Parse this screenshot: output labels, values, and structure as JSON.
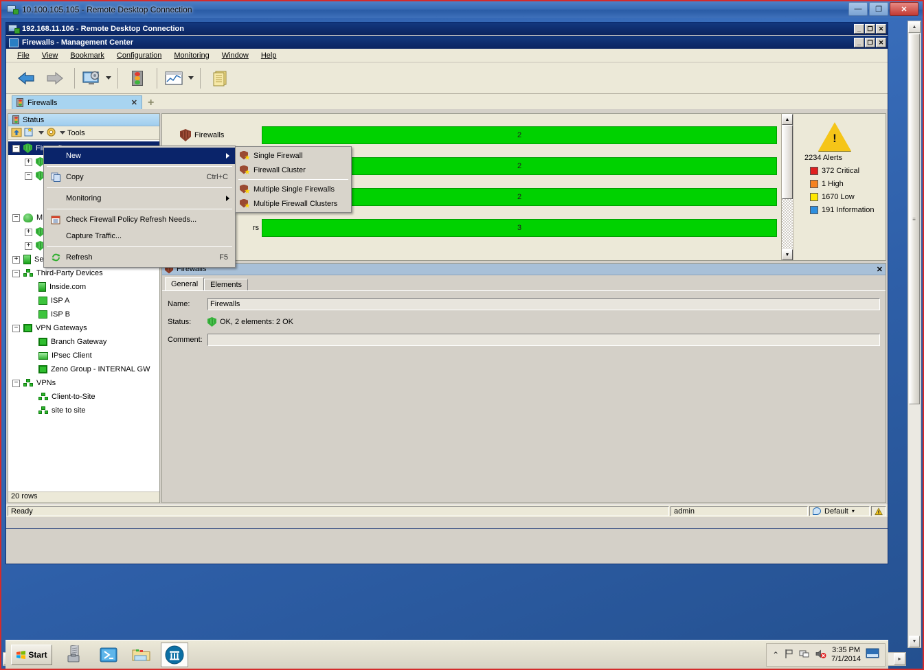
{
  "outer_window": {
    "title": "10.100.105.105 - Remote Desktop Connection",
    "icon": "remote-desktop-icon",
    "minimize": "—",
    "maximize": "❐",
    "close": "✕"
  },
  "inner_window": {
    "title": "192.168.11.106 - Remote Desktop Connection",
    "icon": "remote-desktop-icon",
    "minimize": "_",
    "restore": "❐",
    "close": "✕"
  },
  "app_window": {
    "title": "Firewalls - Management Center",
    "icon": "management-center-icon",
    "minimize": "_",
    "restore": "❐",
    "close": "✕"
  },
  "menubar": [
    {
      "label": "File",
      "accel": "F"
    },
    {
      "label": "View",
      "accel": "V"
    },
    {
      "label": "Bookmark",
      "accel": "B"
    },
    {
      "label": "Configuration",
      "accel": "C"
    },
    {
      "label": "Monitoring",
      "accel": "M"
    },
    {
      "label": "Window",
      "accel": "W"
    },
    {
      "label": "Help",
      "accel": "H"
    }
  ],
  "toolbar": {
    "back": "back-arrow-icon",
    "forward": "forward-arrow-icon",
    "monitoring_view": "monitoring-view-icon",
    "status_view": "traffic-light-icon",
    "reports": "chart-icon",
    "logs": "documents-icon"
  },
  "tabs": [
    {
      "label": "Firewalls",
      "icon": "traffic-light-icon",
      "close": "✕",
      "active": true
    }
  ],
  "tab_add": "+",
  "left_pane": {
    "header": {
      "title": "Status",
      "icon": "traffic-light-icon"
    },
    "tools": {
      "up_icon": "up-folder-icon",
      "new_icon": "new-element-icon",
      "gear_icon": "gear-icon",
      "tools_label": "Tools"
    },
    "tree": [
      {
        "label": "Firewalls",
        "indent": 0,
        "expander": "−",
        "icon": "shield-green",
        "selected": true
      },
      {
        "label": "",
        "indent": 1,
        "expander": "+",
        "icon": "shield-green",
        "selected": false
      },
      {
        "label": "",
        "indent": 1,
        "expander": "−",
        "icon": "shield-green",
        "selected": false
      },
      {
        "label": "",
        "indent": 2,
        "expander": "",
        "icon": "",
        "selected": false
      },
      {
        "label": "",
        "indent": 2,
        "expander": "",
        "icon": "",
        "selected": false
      },
      {
        "label": "M",
        "indent": 0,
        "expander": "−",
        "icon": "ips-green",
        "selected": false
      },
      {
        "label": "",
        "indent": 1,
        "expander": "+",
        "icon": "shield-green",
        "selected": false
      },
      {
        "label": "",
        "indent": 1,
        "expander": "+",
        "icon": "shield-green",
        "selected": false
      },
      {
        "label": "Servers",
        "indent": 0,
        "expander": "+",
        "icon": "server-green",
        "selected": false
      },
      {
        "label": "Third-Party Devices",
        "indent": 0,
        "expander": "−",
        "icon": "thirdparty-green",
        "selected": false
      },
      {
        "label": "Inside.com",
        "indent": 1,
        "expander": "",
        "icon": "server-green",
        "selected": false
      },
      {
        "label": "ISP A",
        "indent": 1,
        "expander": "",
        "icon": "router-green",
        "selected": false
      },
      {
        "label": "ISP B",
        "indent": 1,
        "expander": "",
        "icon": "router-green",
        "selected": false
      },
      {
        "label": "VPN Gateways",
        "indent": 0,
        "expander": "−",
        "icon": "gateway-green",
        "selected": false
      },
      {
        "label": "Branch Gateway",
        "indent": 1,
        "expander": "",
        "icon": "gateway-green",
        "selected": false
      },
      {
        "label": "IPsec Client",
        "indent": 1,
        "expander": "",
        "icon": "laptop-green",
        "selected": false
      },
      {
        "label": "Zeno Group -  INTERNAL GW",
        "indent": 1,
        "expander": "",
        "icon": "gateway-green",
        "selected": false
      },
      {
        "label": "VPNs",
        "indent": 0,
        "expander": "−",
        "icon": "vpn-green",
        "selected": false
      },
      {
        "label": "Client-to-Site",
        "indent": 1,
        "expander": "",
        "icon": "vpn-green",
        "selected": false
      },
      {
        "label": "site to site",
        "indent": 1,
        "expander": "",
        "icon": "vpn-green",
        "selected": false
      }
    ],
    "footer": "20 rows"
  },
  "context_menu": {
    "items": [
      {
        "label": "New",
        "accel": "N",
        "shortcut": "",
        "icon": "",
        "submenu": true,
        "highlighted": true,
        "separator_after": true
      },
      {
        "label": "Copy",
        "accel": "C",
        "shortcut": "Ctrl+C",
        "icon": "copy-icon",
        "submenu": false,
        "highlighted": false,
        "separator_after": true
      },
      {
        "label": "Monitoring",
        "accel": "M",
        "shortcut": "",
        "icon": "",
        "submenu": true,
        "highlighted": false,
        "separator_after": true
      },
      {
        "label": "Check Firewall Policy Refresh Needs...",
        "accel": "",
        "shortcut": "",
        "icon": "policy-refresh-icon",
        "submenu": false,
        "highlighted": false,
        "separator_after": false
      },
      {
        "label": "Capture Traffic...",
        "accel": "",
        "shortcut": "",
        "icon": "",
        "submenu": false,
        "highlighted": false,
        "separator_after": true
      },
      {
        "label": "Refresh",
        "accel": "R",
        "shortcut": "F5",
        "icon": "refresh-icon",
        "submenu": false,
        "highlighted": false,
        "separator_after": false
      }
    ]
  },
  "submenu": {
    "items": [
      {
        "label": "Single Firewall",
        "icon": "new-firewall-icon",
        "separator_after": false
      },
      {
        "label": "Firewall Cluster",
        "icon": "new-firewall-icon",
        "separator_after": true
      },
      {
        "label": "Multiple Single Firewalls",
        "icon": "new-firewall-icon",
        "separator_after": false
      },
      {
        "label": "Multiple Firewall Clusters",
        "icon": "new-firewall-icon",
        "separator_after": false
      }
    ]
  },
  "status_view": {
    "rows": [
      {
        "label": "Firewalls",
        "icon": "shield-dark-icon",
        "value": "2",
        "bar_color": "#00d200"
      },
      {
        "label": "",
        "icon": "",
        "value": "2",
        "bar_color": "#00d200"
      },
      {
        "label": "",
        "icon": "",
        "value": "2",
        "bar_color": "#00d200"
      },
      {
        "label": "rs",
        "icon": "",
        "value": "3",
        "bar_color": "#00d200"
      }
    ],
    "scroll_up": "▲",
    "scroll_down": "▼"
  },
  "alerts_panel": {
    "icon": "warning-triangle-icon",
    "total": "2234 Alerts",
    "levels": [
      {
        "count": "372 Critical",
        "color": "#e02020"
      },
      {
        "count": "1 High",
        "color": "#f58220"
      },
      {
        "count": "1670 Low",
        "color": "#ffe800"
      },
      {
        "count": "191 Information",
        "color": "#2e8fdf"
      }
    ]
  },
  "properties_panel": {
    "title": "Firewalls",
    "icon": "firewall-group-icon",
    "close": "✕",
    "tabs": [
      {
        "label": "General",
        "active": true
      },
      {
        "label": "Elements",
        "active": false
      }
    ],
    "fields": {
      "name_label": "Name:",
      "name_value": "Firewalls",
      "status_label": "Status:",
      "status_value": "OK, 2 elements: 2 OK",
      "status_icon": "shield-green-icon",
      "comment_label": "Comment:",
      "comment_value": ""
    }
  },
  "app_statusbar": {
    "ready": "Ready",
    "user": "admin",
    "domain": "Default",
    "domain_icon": "domain-icon",
    "domain_caret": "▾",
    "warning_icon": "warning-icon"
  },
  "taskbar": {
    "start": "Start",
    "items": [
      {
        "name": "server-manager-icon",
        "active": false
      },
      {
        "name": "powershell-icon",
        "active": false
      },
      {
        "name": "file-explorer-icon",
        "active": false
      },
      {
        "name": "management-client-icon",
        "active": true
      }
    ],
    "tray": {
      "show_hidden": "⌃",
      "flag_icon": "action-center-flag-icon",
      "network_icon": "network-icon",
      "volume_icon": "volume-muted-icon",
      "time": "3:35 PM",
      "date": "7/1/2014",
      "show_desktop": "show-desktop-icon"
    }
  },
  "outer_scrollbars": {
    "v_up": "▲",
    "v_down": "▼",
    "h_left": "◄",
    "h_right": "►",
    "grip": "|||"
  }
}
